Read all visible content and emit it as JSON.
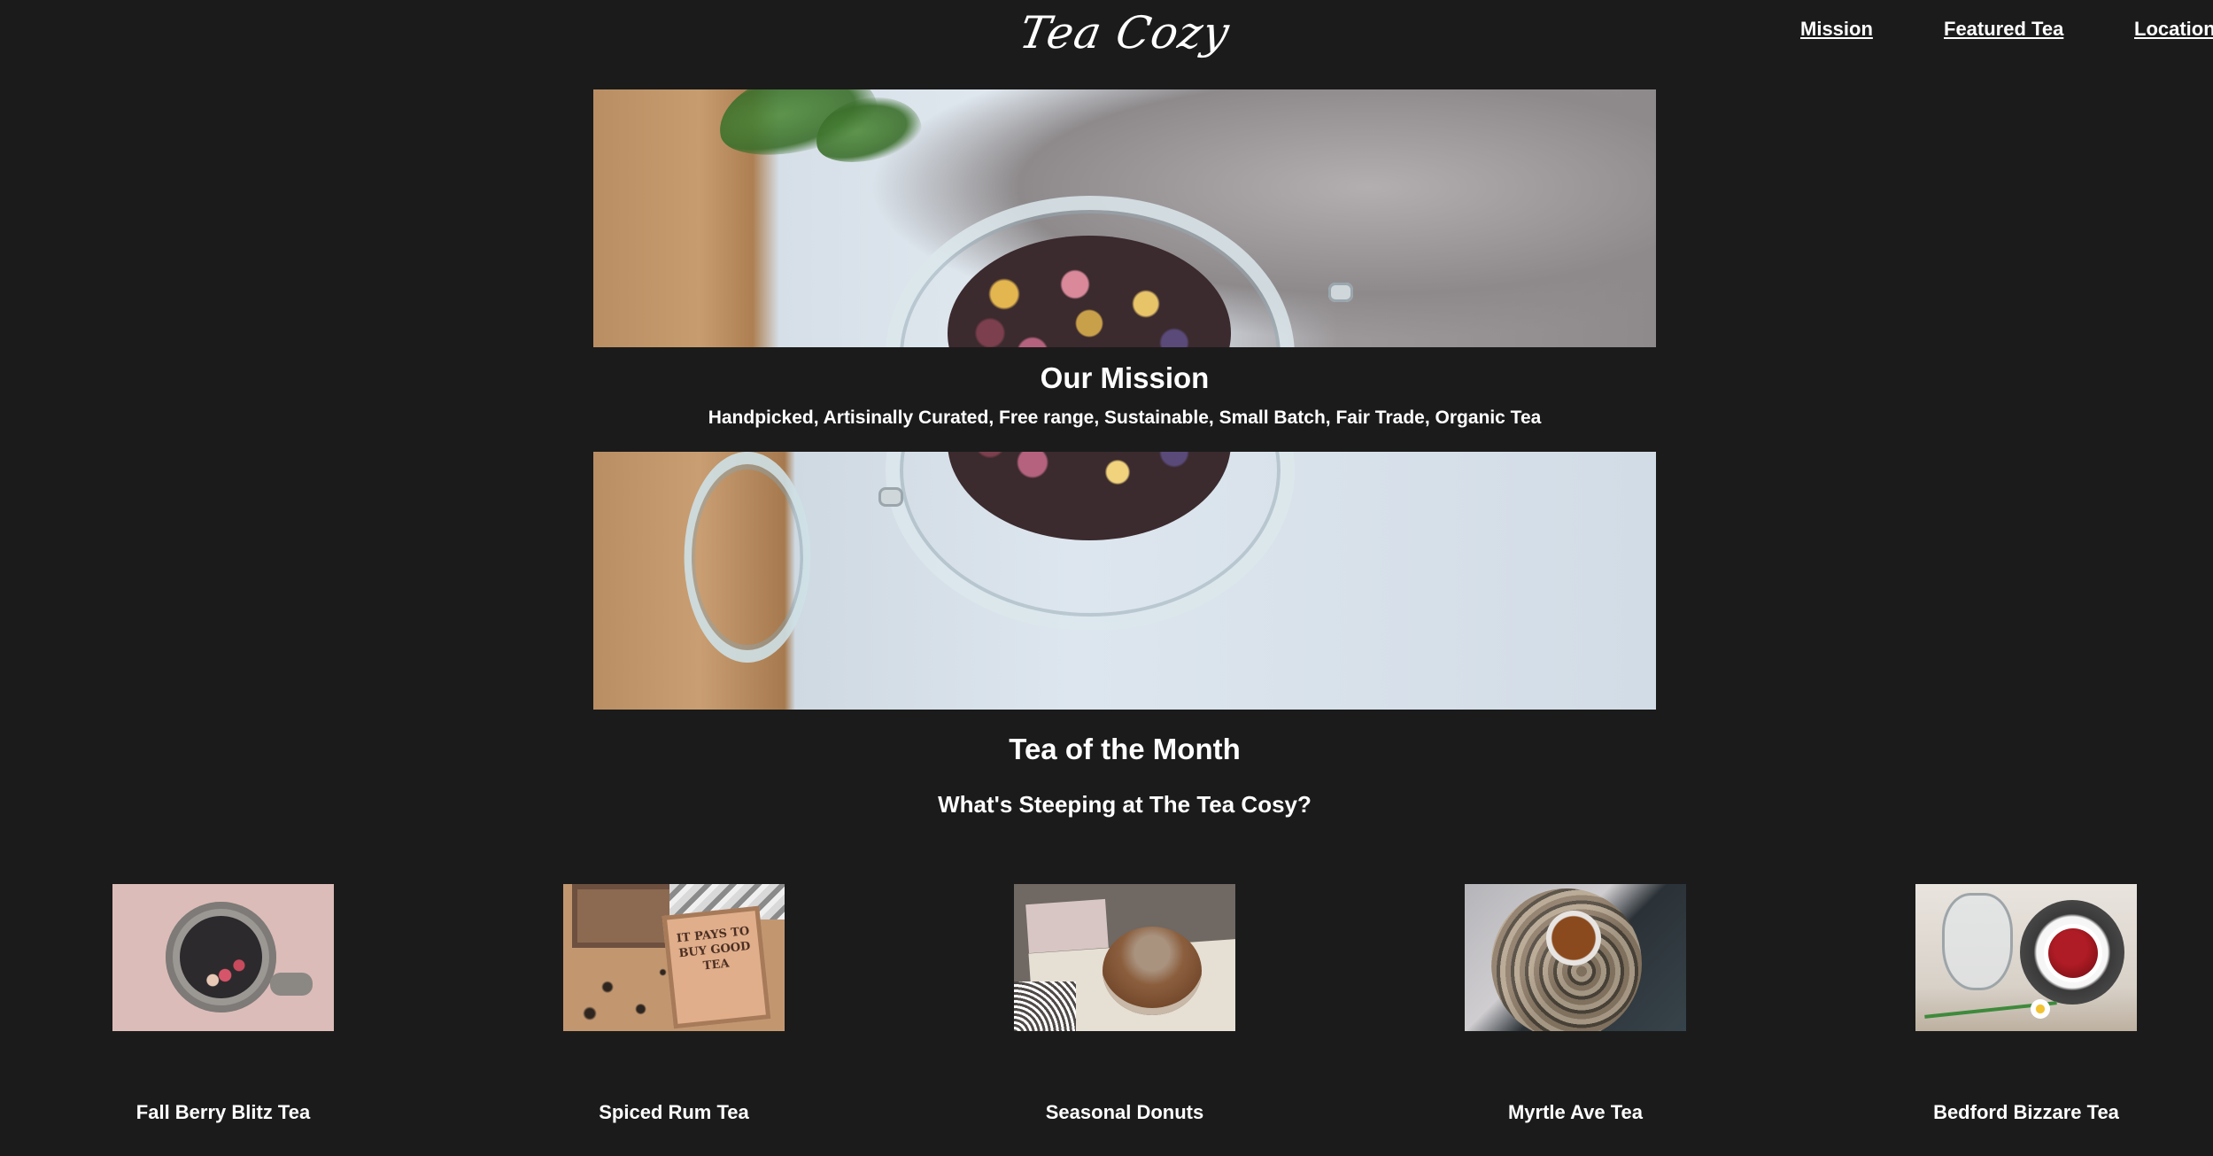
{
  "header": {
    "logo_text": "Tea Cozy",
    "nav": [
      {
        "label": "Mission"
      },
      {
        "label": "Featured Tea"
      },
      {
        "label": "Locations"
      }
    ]
  },
  "mission": {
    "title": "Our Mission",
    "text": "Handpicked, Artisinally Curated, Free range, Sustainable, Small Batch, Fair Trade, Organic Tea"
  },
  "tea_of_month": {
    "title": "Tea of the Month",
    "subtitle": "What's Steeping at The Tea Cosy?",
    "items": [
      {
        "name": "Fall Berry Blitz Tea"
      },
      {
        "name": "Spiced Rum Tea"
      },
      {
        "name": "Seasonal Donuts"
      },
      {
        "name": "Myrtle Ave Tea"
      },
      {
        "name": "Bedford Bizzare Tea"
      }
    ]
  },
  "images": {
    "box_text": "IT PAYS TO BUY GOOD TEA"
  },
  "colors": {
    "background": "#1b1b1b",
    "text": "#ffffff"
  }
}
